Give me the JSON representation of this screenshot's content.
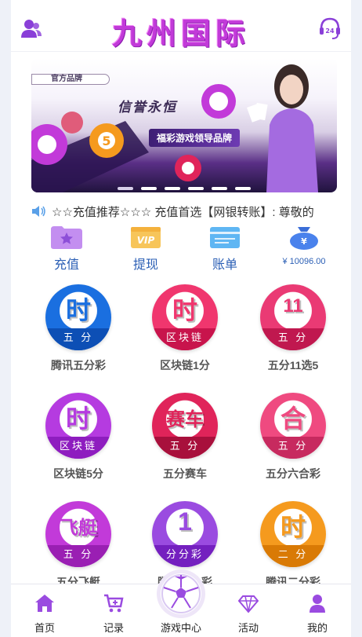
{
  "header": {
    "title": "九州国际",
    "left_icon": "user-group-icon",
    "right_icon": "customer-service-24-icon"
  },
  "banner": {
    "tag": "官方品牌",
    "slogan1": "信誉永恒",
    "slogan2": "福彩游戏领导品牌",
    "ball_number": "5",
    "dots": 6
  },
  "notice": {
    "icon": "speaker-icon",
    "text": "☆☆充值推荐☆☆☆ 充值首选【网银转账】: 尊敬的"
  },
  "quick_actions": [
    {
      "label": "充值",
      "icon": "recharge-star-icon",
      "color": "#a66be0"
    },
    {
      "label": "提现",
      "icon": "vip-card-icon",
      "color": "#f3b63f"
    },
    {
      "label": "账单",
      "icon": "bill-card-icon",
      "color": "#4aa8f0"
    },
    {
      "label": "¥ 10096.00",
      "icon": "money-bag-icon",
      "color": "#3b6ed8"
    }
  ],
  "games": [
    {
      "name": "腾讯五分彩",
      "big": "时",
      "band": "五 分",
      "color": "#1a6fe0",
      "band_color": "#0d4fb5"
    },
    {
      "name": "区块链1分",
      "big": "时",
      "band": "区块链",
      "color": "#f0366e",
      "band_color": "#c8144c"
    },
    {
      "name": "五分11选5",
      "big": "11",
      "band": "五 分",
      "color": "#ea3a74",
      "band_color": "#c0184f"
    },
    {
      "name": "区块链5分",
      "big": "时",
      "band": "区块链",
      "color": "#b53be0",
      "band_color": "#8e1dbf"
    },
    {
      "name": "五分赛车",
      "big": "赛车",
      "band": "五 分",
      "color": "#e0245a",
      "band_color": "#a8103c"
    },
    {
      "name": "五分六合彩",
      "big": "合",
      "band": "五 分",
      "color": "#ef4a80",
      "band_color": "#c72a5f"
    },
    {
      "name": "五分飞艇",
      "big": "飞艇",
      "band": "五 分",
      "color": "#c23ad9",
      "band_color": "#9a1fb3"
    },
    {
      "name": "腾讯分分彩",
      "big": "1",
      "band": "分分彩",
      "color": "#9a4be0",
      "band_color": "#7420bf"
    },
    {
      "name": "腾讯二分彩",
      "big": "时",
      "band": "二 分",
      "color": "#f59a1e",
      "band_color": "#d97a05"
    }
  ],
  "bottom_nav": [
    {
      "label": "首页",
      "icon": "home-icon"
    },
    {
      "label": "记录",
      "icon": "cart-record-icon"
    },
    {
      "label": "游戏中心",
      "icon": "soccer-ball-icon"
    },
    {
      "label": "活动",
      "icon": "diamond-icon"
    },
    {
      "label": "我的",
      "icon": "person-icon"
    }
  ],
  "colors": {
    "accent": "#9a4be0",
    "link_blue": "#2b5fb5"
  }
}
